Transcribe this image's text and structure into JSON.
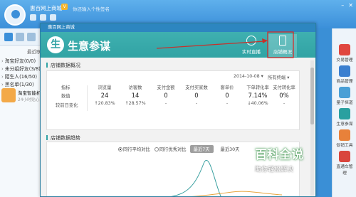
{
  "client": {
    "name": "惠百网上商城",
    "vip": "V",
    "signature": "你还输入个性签名",
    "recent_label": "最近联系人",
    "groups": [
      {
        "label": "淘宝好友(0/0)"
      },
      {
        "label": "未分组好友(3/8)"
      },
      {
        "label": "陌生人(16/50)"
      },
      {
        "label": "黑名单(1/30)"
      }
    ],
    "contact": {
      "name": "淘宝智能机器人",
      "sub": "24小时贴心服务"
    },
    "apps": [
      {
        "label": "交易管理",
        "color": "#e0463f"
      },
      {
        "label": "商品管理",
        "color": "#3b7fd0"
      },
      {
        "label": "量子恒道",
        "color": "#4a9fd6"
      },
      {
        "label": "生意参谋",
        "color": "#2aa0a0"
      },
      {
        "label": "促销工具",
        "color": "#e8813a"
      },
      {
        "label": "直通车管理",
        "color": "#d9453d"
      }
    ]
  },
  "store": {
    "window_title": "惠百网上商城",
    "brand": "生意参谋",
    "brand_icon": "生",
    "tabs": {
      "live": "实时直播",
      "overview": "店铺概况"
    },
    "overview": {
      "title": "店铺数据概况",
      "date": "2014-10-08 ▾",
      "terminal": "所有终端 ▾",
      "row_labels": {
        "metric": "指标",
        "value": "数值",
        "change": "较前日变化"
      },
      "columns": [
        {
          "h": "浏览量",
          "v": "24",
          "c": "20.83%",
          "dir": "up"
        },
        {
          "h": "访客数",
          "v": "14",
          "c": "28.57%",
          "dir": "up"
        },
        {
          "h": "支付金额",
          "v": "0",
          "c": "-",
          "dir": ""
        },
        {
          "h": "支付买家数",
          "v": "0",
          "c": "-",
          "dir": ""
        },
        {
          "h": "客单价",
          "v": "0",
          "c": "-",
          "dir": ""
        },
        {
          "h": "下单转化率",
          "v": "7.14%",
          "c": "40.06%",
          "dir": "down"
        },
        {
          "h": "支付转化率",
          "v": "0%",
          "c": "-",
          "dir": ""
        }
      ]
    },
    "trend": {
      "title": "店铺数据趋势",
      "radio1": "同行平均对比",
      "radio2": "同行优秀对比",
      "range1": "最近7天",
      "range2": "最近30天"
    }
  },
  "watermark": {
    "big": "百科全说",
    "small": "助你轻松解决"
  }
}
